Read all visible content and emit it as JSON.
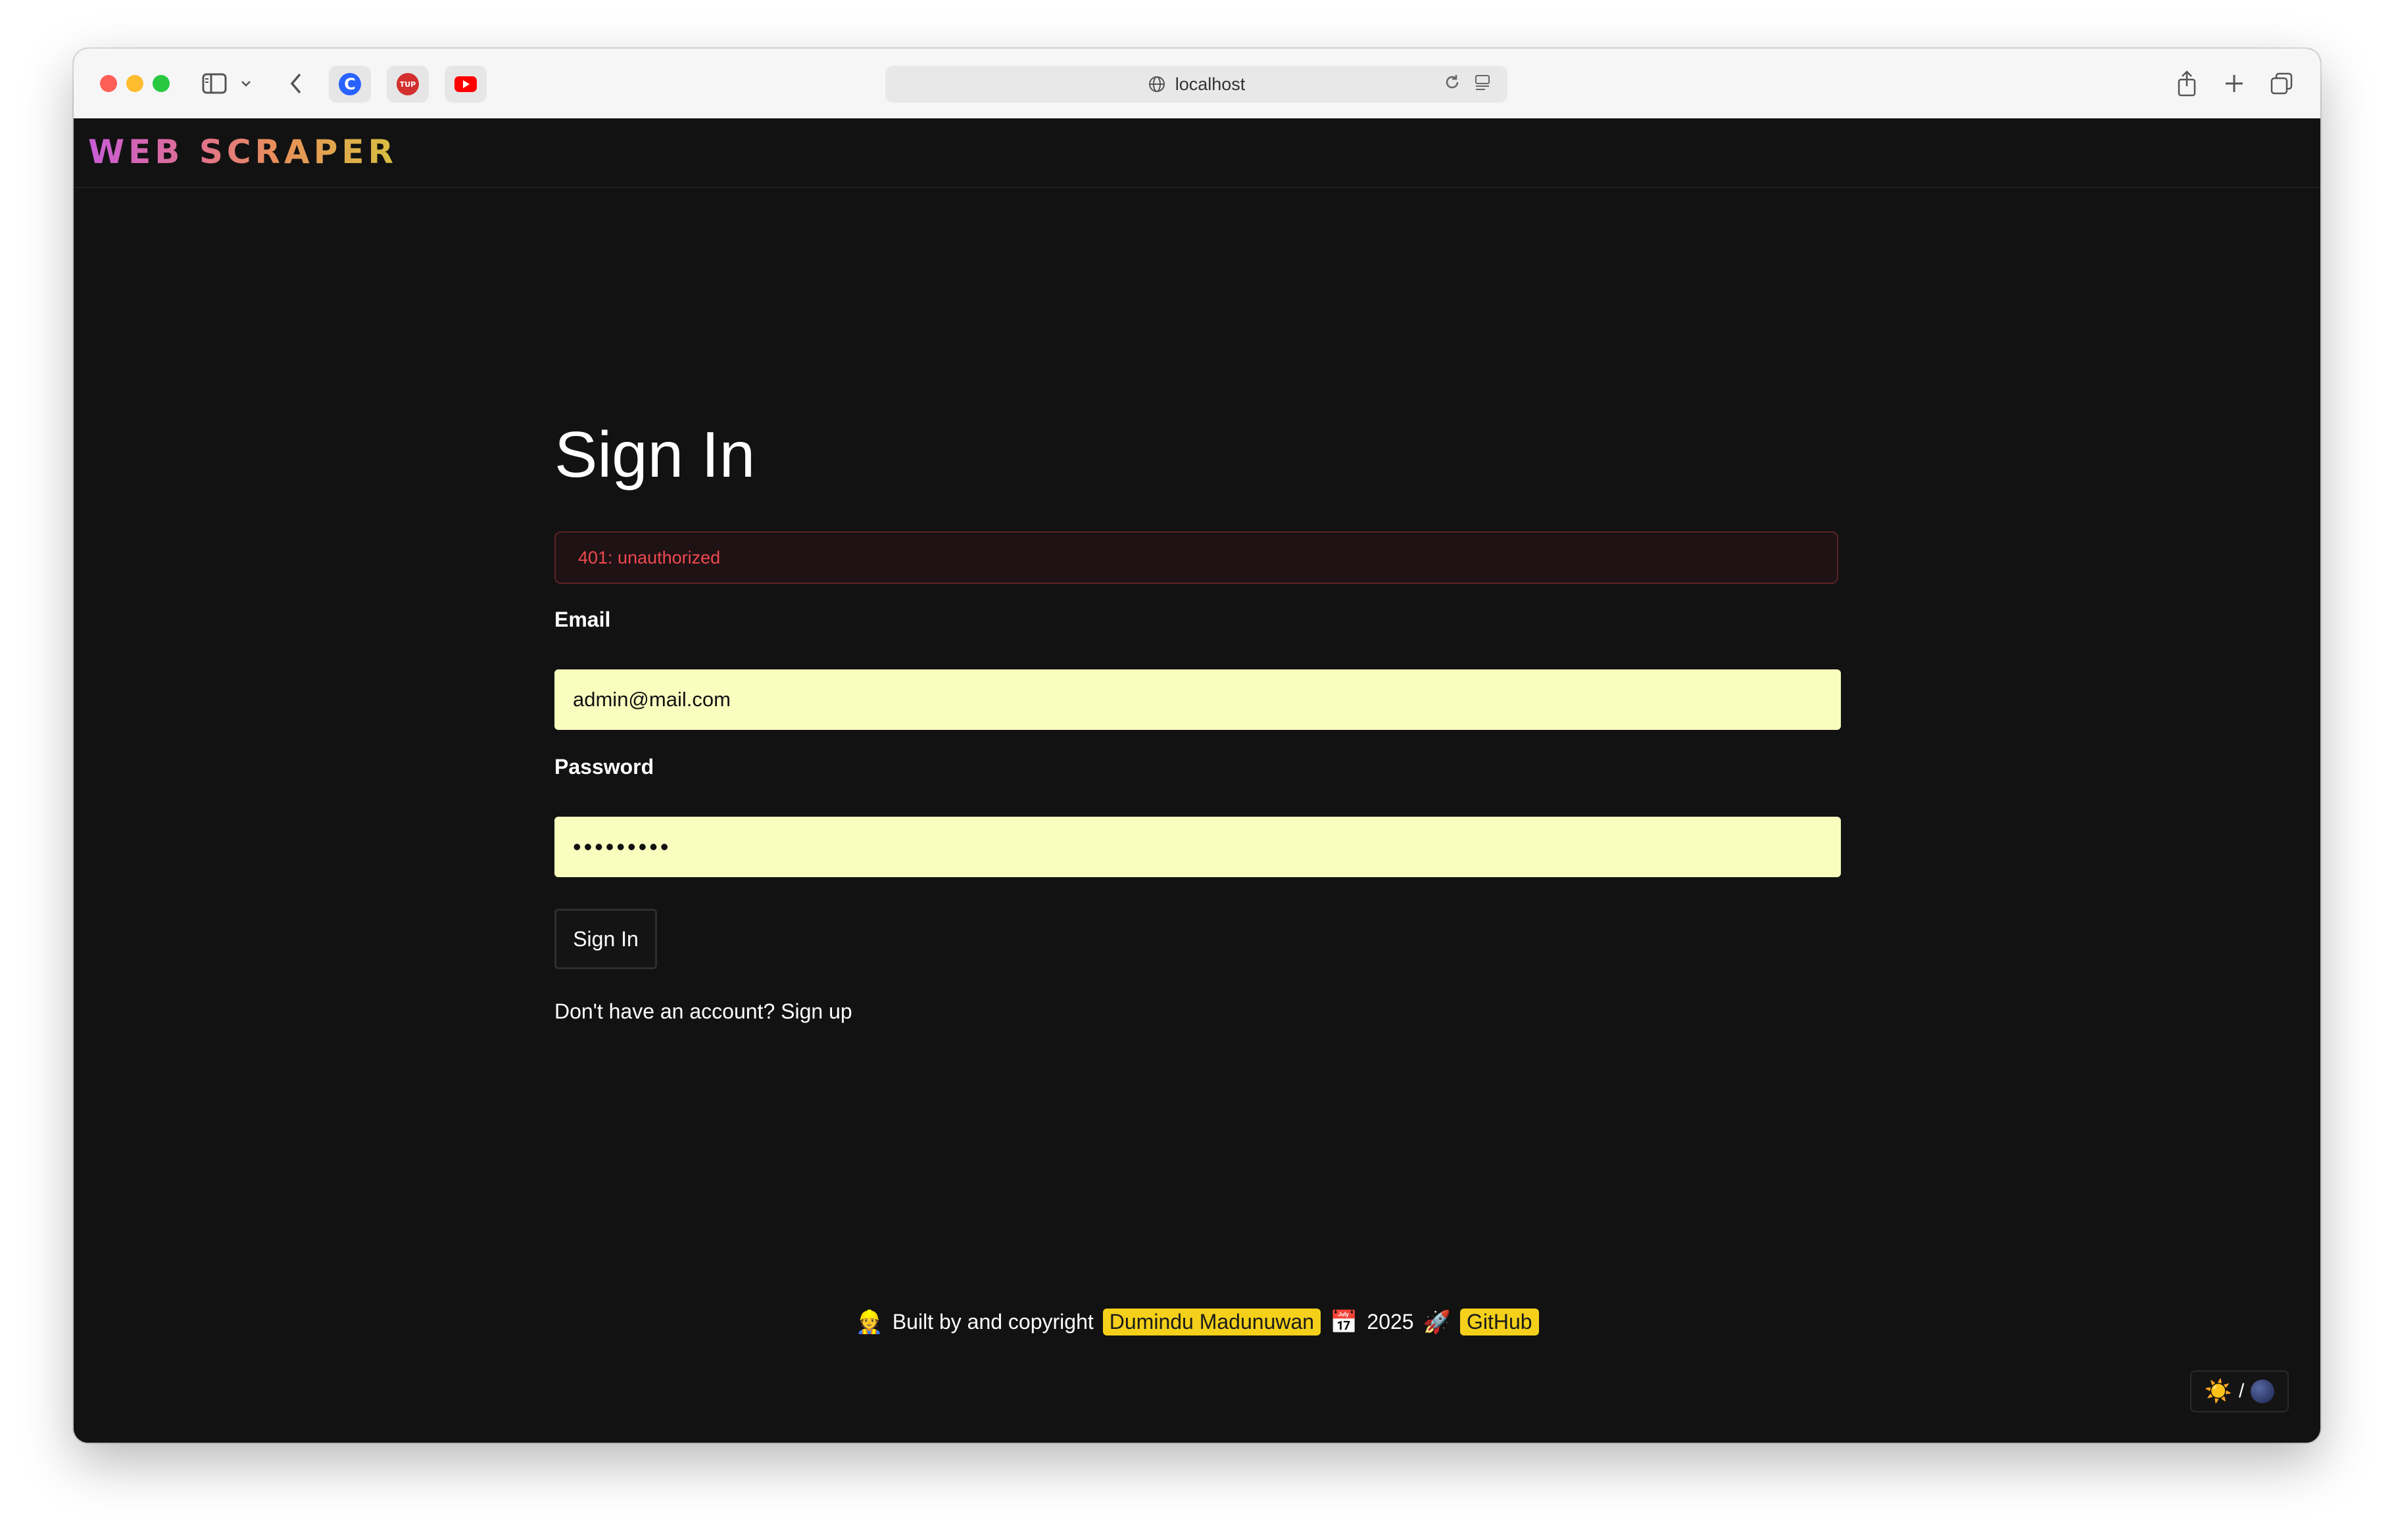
{
  "browser": {
    "url": "localhost",
    "favicons": [
      {
        "name": "c-icon",
        "color": "#2962ff"
      },
      {
        "name": "tup-icon",
        "color": "#d32f2f",
        "text": "TUP"
      },
      {
        "name": "youtube-icon",
        "color": "#ff0000"
      }
    ]
  },
  "nav": {
    "logo": "WEB SCRAPER"
  },
  "signin": {
    "title": "Sign In",
    "error": "401: unauthorized",
    "email_label": "Email",
    "email_value": "admin@mail.com",
    "password_label": "Password",
    "password_value": "•••••••••",
    "submit_label": "Sign In",
    "signup_prompt": "Don't have an account?",
    "signup_link": "Sign up"
  },
  "footer": {
    "builder_emoji": "👷",
    "built_text": "Built by and copyright",
    "author": "Dumindu Madunuwan",
    "calendar_emoji": "📅",
    "year": "2025",
    "rocket_emoji": "🚀",
    "github": "GitHub"
  },
  "theme_toggle": {
    "sun": "☀️",
    "separator": "/"
  },
  "colors": {
    "background": "#121212",
    "input_bg": "#f9fdbe",
    "error_text": "#f0484f",
    "highlight": "#f4d01a"
  }
}
